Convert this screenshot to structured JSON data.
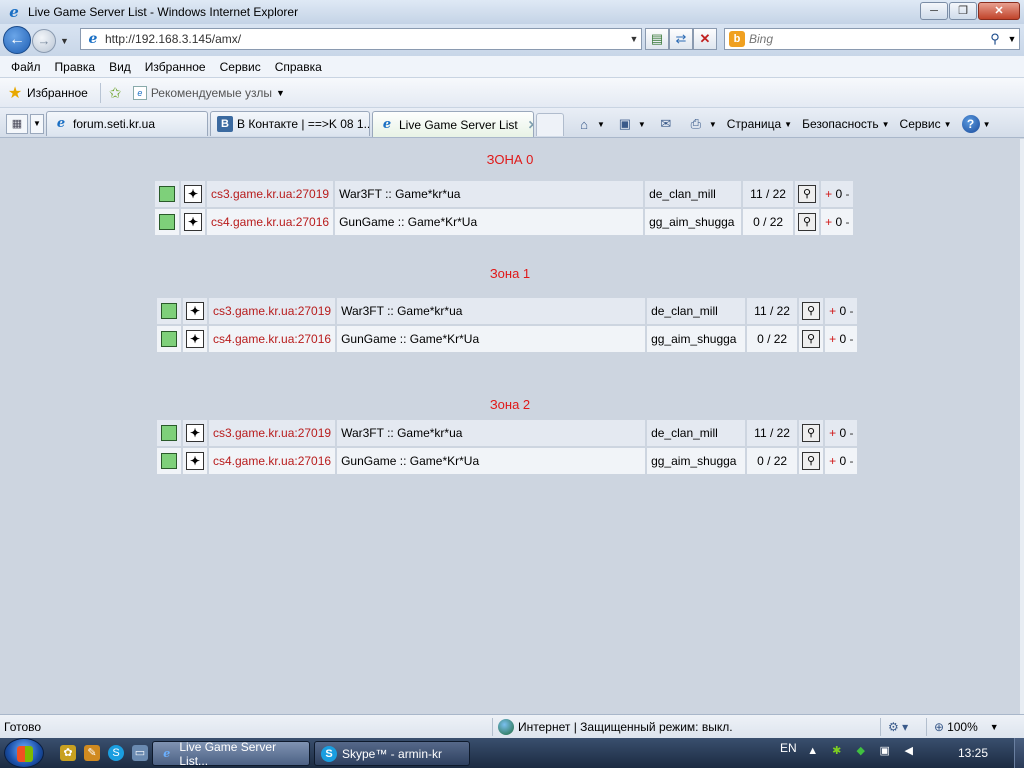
{
  "window": {
    "title": "Live Game Server List - Windows Internet Explorer",
    "minimize": "─",
    "maximize": "❐",
    "close": "✕"
  },
  "nav": {
    "url": "http://192.168.3.145/amx/",
    "search_placeholder": "Bing",
    "back_glyph": "←",
    "forward_glyph": "→"
  },
  "menu": [
    "Файл",
    "Правка",
    "Вид",
    "Избранное",
    "Сервис",
    "Справка"
  ],
  "favorites": {
    "label": "Избранное",
    "recommended": "Рекомендуемые узлы"
  },
  "tabs": [
    {
      "label": "forum.seti.kr.ua",
      "icon": "ie-page-icon"
    },
    {
      "label": "В Контакте | ==>K 08 1...",
      "icon": "vk-icon"
    },
    {
      "label": "Live Game Server List",
      "icon": "ie-page-icon",
      "active": true
    }
  ],
  "commands": {
    "page": "Страница",
    "safety": "Безопасность",
    "tools": "Сервис"
  },
  "zones": [
    {
      "title": "ЗОНА 0",
      "servers": [
        {
          "address": "cs3.game.kr.ua:27019",
          "name": "War3FT :: Game*kr*ua",
          "map": "de_clan_mill",
          "players": "11 / 22",
          "plus": "+",
          "score": "0",
          "minus": "-"
        },
        {
          "address": "cs4.game.kr.ua:27016",
          "name": "GunGame :: Game*Kr*Ua",
          "map": "gg_aim_shugga",
          "players": "0 / 22",
          "plus": "+",
          "score": "0",
          "minus": "-"
        }
      ]
    },
    {
      "title": "Зона 1",
      "servers": [
        {
          "address": "cs3.game.kr.ua:27019",
          "name": "War3FT :: Game*kr*ua",
          "map": "de_clan_mill",
          "players": "11 / 22",
          "plus": "+",
          "score": "0",
          "minus": "-"
        },
        {
          "address": "cs4.game.kr.ua:27016",
          "name": "GunGame :: Game*Kr*Ua",
          "map": "gg_aim_shugga",
          "players": "0 / 22",
          "plus": "+",
          "score": "0",
          "minus": "-"
        }
      ]
    },
    {
      "title": "Зона 2",
      "servers": [
        {
          "address": "cs3.game.kr.ua:27019",
          "name": "War3FT :: Game*kr*ua",
          "map": "de_clan_mill",
          "players": "11 / 22",
          "plus": "+",
          "score": "0",
          "minus": "-"
        },
        {
          "address": "cs4.game.kr.ua:27016",
          "name": "GunGame :: Game*Kr*Ua",
          "map": "gg_aim_shugga",
          "players": "0 / 22",
          "plus": "+",
          "score": "0",
          "minus": "-"
        }
      ]
    }
  ],
  "status": {
    "text": "Готово",
    "zone": "Интернет | Защищенный режим: выкл.",
    "zoom": "100%"
  },
  "taskbar": {
    "tasks": [
      {
        "label": "Live Game Server List...",
        "active": true
      },
      {
        "label": "Skype™ - armin-kr",
        "active": false
      }
    ],
    "lang": "EN",
    "clock": "13:25"
  },
  "colors": {
    "zone_title": "#e01818",
    "server_link": "#b81c1c",
    "status_online": "#7ed07a",
    "page_bg": "#cdd5e0"
  }
}
